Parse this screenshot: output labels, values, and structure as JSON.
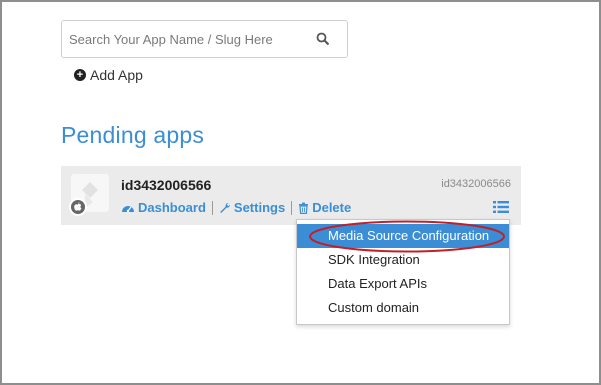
{
  "search": {
    "placeholder": "Search Your App Name / Slug Here",
    "value": ""
  },
  "add_app": {
    "label": "Add App"
  },
  "pending": {
    "title": "Pending apps"
  },
  "app": {
    "name": "id3432006566",
    "id_label": "id3432006566",
    "platform_icon": "apple-icon",
    "actions": {
      "dashboard": "Dashboard",
      "settings": "Settings",
      "delete": "Delete"
    }
  },
  "menu": {
    "items": [
      {
        "label": "Media Source Configuration",
        "active": true
      },
      {
        "label": "SDK Integration"
      },
      {
        "label": "Data Export APIs"
      },
      {
        "label": "Custom domain"
      }
    ]
  },
  "colors": {
    "accent": "#3b8ed6",
    "highlight_oval": "#c0202a",
    "card_bg": "#ebebeb"
  }
}
